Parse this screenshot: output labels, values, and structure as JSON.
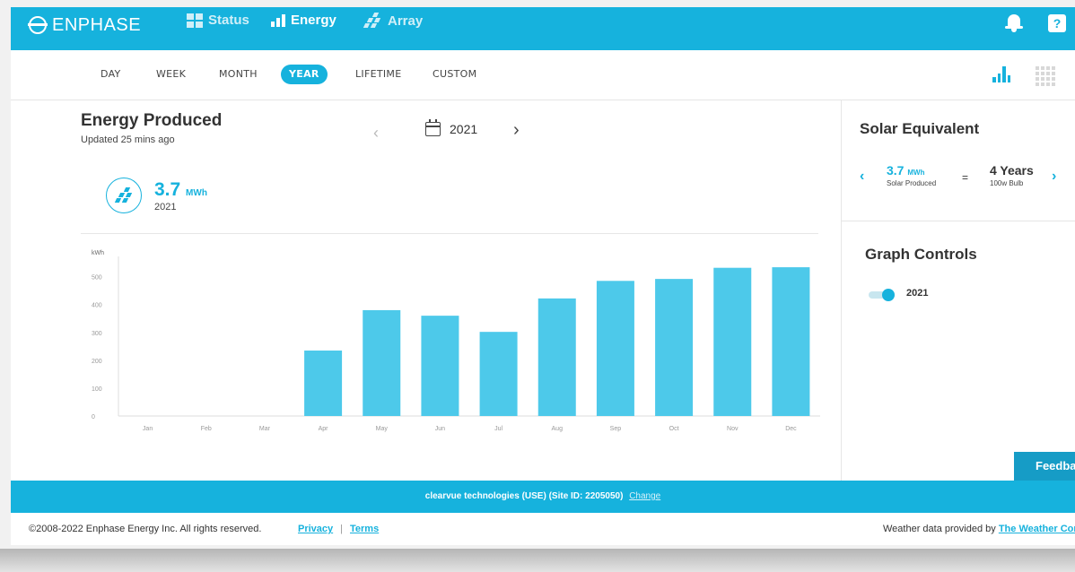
{
  "header": {
    "brand": "ENPHASE",
    "nav": [
      {
        "label": "Status",
        "icon": "grid-icon"
      },
      {
        "label": "Energy",
        "icon": "bar-chart-icon"
      },
      {
        "label": "Array",
        "icon": "solar-array-icon"
      }
    ],
    "help_label": "?"
  },
  "tabs": [
    "DAY",
    "WEEK",
    "MONTH",
    "YEAR",
    "LIFETIME",
    "CUSTOM"
  ],
  "active_tab": "YEAR",
  "energy": {
    "title": "Energy Produced",
    "updated": "Updated 25 mins ago",
    "period": "2021",
    "produced_value": "3.7",
    "produced_unit": "MWh",
    "produced_year": "2021"
  },
  "solar_equivalent": {
    "title": "Solar Equivalent",
    "produced_value": "3.7",
    "produced_unit": "MWh",
    "produced_label": "Solar Produced",
    "equals": "=",
    "equivalent_value": "4 Years",
    "equivalent_label": "100w Bulb"
  },
  "graph_controls": {
    "title": "Graph Controls",
    "series_label": "2021",
    "series_enabled": true
  },
  "feedback_label": "Feedback",
  "footer": {
    "site": "clearvue technologies (USE) (Site ID: 2205050)",
    "change": "Change",
    "copyright": "©2008-2022 Enphase Energy Inc. All rights reserved.",
    "privacy": "Privacy",
    "separator": "|",
    "terms": "Terms",
    "weather_prefix": "Weather data provided by ",
    "weather_link": "The Weather Company"
  },
  "colors": {
    "accent": "#16b2dd",
    "bar": "#4dc9ea",
    "footer": "#16b2dd"
  },
  "chart_data": {
    "type": "bar",
    "ylabel": "kWh",
    "categories": [
      "Jan",
      "Feb",
      "Mar",
      "Apr",
      "May",
      "Jun",
      "Jul",
      "Aug",
      "Sep",
      "Oct",
      "Nov",
      "Dec"
    ],
    "values": [
      0,
      0,
      0,
      235,
      380,
      360,
      302,
      422,
      485,
      492,
      532,
      534
    ],
    "yticks": [
      0,
      100,
      200,
      300,
      400,
      500
    ],
    "ylim": [
      0,
      560
    ],
    "grid": false
  }
}
